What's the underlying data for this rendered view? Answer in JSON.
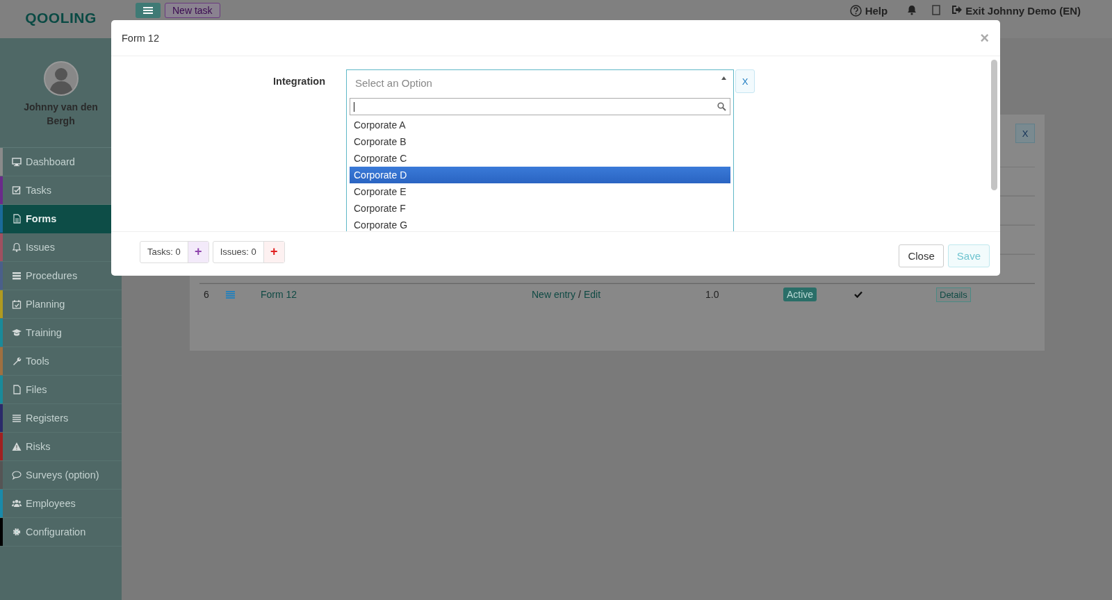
{
  "topbar": {
    "logo": "QOOLING",
    "new_task": "New task",
    "help": "Help",
    "exit": "Exit Johnny Demo (EN)"
  },
  "sidebar": {
    "user_name": "Johnny van den Bergh",
    "items": [
      {
        "label": "Dashboard",
        "selected": false,
        "color": "#8a8a8a"
      },
      {
        "label": "Tasks",
        "selected": false,
        "color": "#6a2a8a"
      },
      {
        "label": "Forms",
        "selected": true,
        "color": "#1a6a9a"
      },
      {
        "label": "Issues",
        "selected": false,
        "color": "#a05060"
      },
      {
        "label": "Procedures",
        "selected": false,
        "color": "#4a5f8a"
      },
      {
        "label": "Planning",
        "selected": false,
        "color": "#b09a20"
      },
      {
        "label": "Training",
        "selected": false,
        "color": "#1a8a9a"
      },
      {
        "label": "Tools",
        "selected": false,
        "color": "#a07040"
      },
      {
        "label": "Files",
        "selected": false,
        "color": "#1a8a9a"
      },
      {
        "label": "Registers",
        "selected": false,
        "color": "#2a2a6a"
      },
      {
        "label": "Risks",
        "selected": false,
        "color": "#a02020"
      },
      {
        "label": "Surveys (option)",
        "selected": false,
        "color": "#555555"
      },
      {
        "label": "Employees",
        "selected": false,
        "color": "#1a8aaa"
      },
      {
        "label": "Configuration",
        "selected": false,
        "color": "#000000"
      }
    ]
  },
  "filter_clear": "X",
  "table": {
    "rows": [
      {
        "number": "6",
        "name": "Form 12",
        "new_entry": "New entry",
        "separator": "/",
        "edit": "Edit",
        "version": "1.0",
        "status": "Active",
        "published": true,
        "details": "Details"
      }
    ]
  },
  "modal": {
    "title": "Form 12",
    "close": "×",
    "field_label": "Integration",
    "select": {
      "placeholder": "Select an Option",
      "expanded": true,
      "clear": "X",
      "options": [
        {
          "label": "Corporate A",
          "selected": false
        },
        {
          "label": "Corporate B",
          "selected": false
        },
        {
          "label": "Corporate C",
          "selected": false
        },
        {
          "label": "Corporate D",
          "selected": true
        },
        {
          "label": "Corporate E",
          "selected": false
        },
        {
          "label": "Corporate F",
          "selected": false
        },
        {
          "label": "Corporate G",
          "selected": false
        }
      ]
    },
    "footer": {
      "tasks": "Tasks: 0",
      "tasks_add": "+",
      "issues": "Issues: 0",
      "issues_add": "+",
      "close": "Close",
      "save": "Save"
    }
  }
}
